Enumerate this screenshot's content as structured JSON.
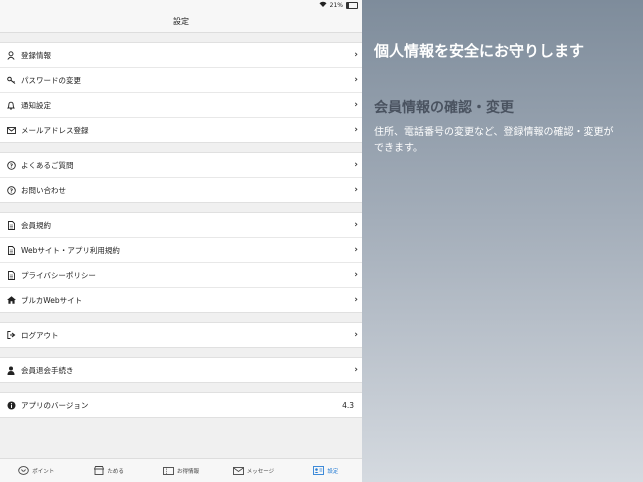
{
  "status": {
    "battery": "21%",
    "battery_level": 0.21
  },
  "nav": {
    "title": "設定"
  },
  "groups": [
    {
      "items": [
        {
          "label": "登録情報",
          "icon": "user-icon"
        },
        {
          "label": "パスワードの変更",
          "icon": "key-icon"
        },
        {
          "label": "通知設定",
          "icon": "bell-icon"
        },
        {
          "label": "メールアドレス登録",
          "icon": "mail-icon"
        }
      ]
    },
    {
      "items": [
        {
          "label": "よくあるご質問",
          "icon": "question-icon"
        },
        {
          "label": "お問い合わせ",
          "icon": "question-icon"
        }
      ]
    },
    {
      "items": [
        {
          "label": "会員規約",
          "icon": "document-icon"
        },
        {
          "label": "Webサイト・アプリ利用規約",
          "icon": "document-icon"
        },
        {
          "label": "プライバシーポリシー",
          "icon": "document-icon"
        },
        {
          "label": "ブルカWebサイト",
          "icon": "home-icon"
        }
      ]
    },
    {
      "items": [
        {
          "label": "ログアウト",
          "icon": "logout-icon"
        }
      ]
    },
    {
      "items": [
        {
          "label": "会員退会手続き",
          "icon": "person-icon"
        }
      ]
    },
    {
      "items": [
        {
          "label": "アプリのバージョン",
          "icon": "info-icon",
          "value": "4.3"
        }
      ]
    }
  ],
  "tabs": [
    {
      "label": "ポイント",
      "icon": "points-icon"
    },
    {
      "label": "ためる",
      "icon": "store-icon"
    },
    {
      "label": "お得情報",
      "icon": "coupon-icon"
    },
    {
      "label": "メッセージ",
      "icon": "message-icon"
    },
    {
      "label": "設定",
      "icon": "settings-card-icon",
      "active": true
    }
  ],
  "promo": {
    "headline": "個人情報を安全にお守りします",
    "subhead": "会員情報の確認・変更",
    "description": "住所、電話番号の変更など、登録情報の確認・変更ができます。"
  },
  "colors": {
    "accent": "#2a7fd5",
    "promo_top": "#7e8c9b",
    "promo_bottom": "#d5dae0"
  }
}
